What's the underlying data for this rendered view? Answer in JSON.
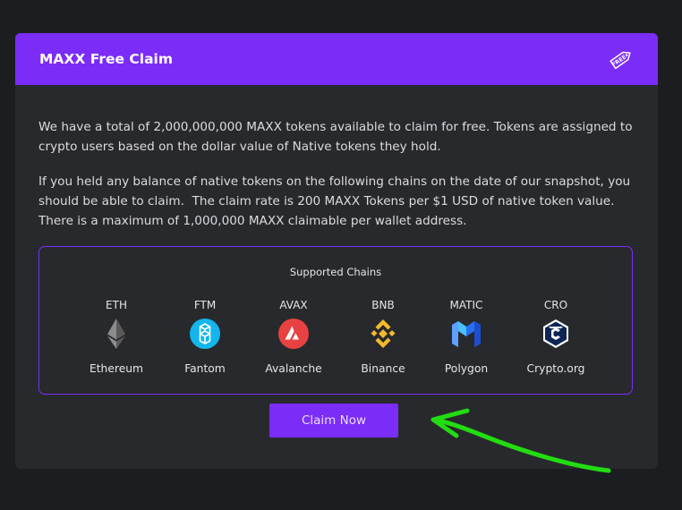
{
  "card": {
    "title": "MAXX Free Claim",
    "tag_icon": "free-tag-icon",
    "paragraphs": [
      "We have a total of 2,000,000,000 MAXX tokens available to claim for free. Tokens are assigned to crypto users based on the dollar value of Native tokens they hold.",
      "If you held any balance of native tokens on the following chains on the date of our snapshot, you should be able to claim.  The claim rate is 200 MAXX Tokens per $1 USD of native token value.  There is a maximum of 1,000,000 MAXX claimable per wallet address."
    ]
  },
  "chains": {
    "title": "Supported Chains",
    "items": [
      {
        "symbol": "ETH",
        "name": "Ethereum",
        "icon": "ethereum-icon"
      },
      {
        "symbol": "FTM",
        "name": "Fantom",
        "icon": "fantom-icon"
      },
      {
        "symbol": "AVAX",
        "name": "Avalanche",
        "icon": "avalanche-icon"
      },
      {
        "symbol": "BNB",
        "name": "Binance",
        "icon": "binance-icon"
      },
      {
        "symbol": "MATIC",
        "name": "Polygon",
        "icon": "polygon-icon"
      },
      {
        "symbol": "CRO",
        "name": "Crypto.org",
        "icon": "crypto-org-icon"
      }
    ]
  },
  "claim_button": {
    "label": "Claim Now"
  },
  "colors": {
    "accent": "#7b2cf6",
    "card_bg": "#28292d",
    "page_bg": "#1c1d21",
    "annotation_arrow": "#22dd11"
  }
}
